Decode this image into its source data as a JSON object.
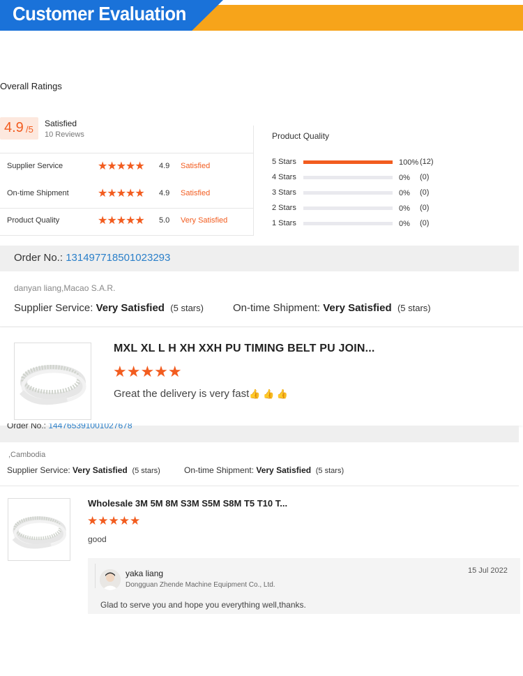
{
  "banner": {
    "title": "Customer Evaluation"
  },
  "overall": {
    "title": "Overall Ratings",
    "score": "4.9",
    "score_suffix": "/5",
    "satisfaction": "Satisfied",
    "reviews": "10 Reviews",
    "rows": [
      {
        "label": "Supplier Service",
        "stars": "★★★★★",
        "score": "4.9",
        "word": "Satisfied"
      },
      {
        "label": "On-time Shipment",
        "stars": "★★★★★",
        "score": "4.9",
        "word": "Satisfied"
      },
      {
        "label": "Product Quality",
        "stars": "★★★★★",
        "score": "5.0",
        "word": "Very Satisfied"
      }
    ]
  },
  "distribution": {
    "title": "Product Quality",
    "rows": [
      {
        "label": "5 Stars",
        "fraction": 1.0,
        "pct": "100%",
        "count": "(12)"
      },
      {
        "label": "4 Stars",
        "fraction": 0.0,
        "pct": "0%",
        "count": "(0)"
      },
      {
        "label": "3 Stars",
        "fraction": 0.0,
        "pct": "0%",
        "count": "(0)"
      },
      {
        "label": "2 Stars",
        "fraction": 0.0,
        "pct": "0%",
        "count": "(0)"
      },
      {
        "label": "1 Stars",
        "fraction": 0.0,
        "pct": "0%",
        "count": "(0)"
      }
    ]
  },
  "review1": {
    "order_label": "Order No.: ",
    "order_number": "131497718501023293",
    "reviewer": "danyan liang,Macao S.A.R.",
    "supplier_label": "Supplier Service: ",
    "supplier_value": "Very Satisfied",
    "supplier_stars": "(5 stars)",
    "shipment_label": "On-time Shipment: ",
    "shipment_value": "Very Satisfied",
    "shipment_stars": "(5 stars)",
    "product_title": "MXL XL L H XH XXH PU TIMING BELT PU JOIN...",
    "stars": "★★★★★",
    "text": "Great the delivery is very fast",
    "emoji": "👍 👍 👍"
  },
  "review2": {
    "order_label": "Order No.: ",
    "order_number": "144765391001027678",
    "reviewer": ",Cambodia",
    "supplier_label": "Supplier Service: ",
    "supplier_value": "Very Satisfied",
    "supplier_stars": "(5 stars)",
    "shipment_label": "On-time Shipment: ",
    "shipment_value": "Very Satisfied",
    "shipment_stars": "(5 stars)",
    "product_title": "Wholesale 3M 5M 8M S3M S5M S8M T5 T10 T...",
    "stars": "★★★★★",
    "text": "good",
    "reply": {
      "name": "yaka liang",
      "company": "Dongguan Zhende Machine Equipment Co., Ltd.",
      "date": "15 Jul 2022",
      "text": "Glad to serve you and hope you everything well,thanks."
    }
  },
  "colors": {
    "accent": "#f25c1f",
    "banner_blue": "#1a72d9",
    "banner_orange": "#f7a41a",
    "link": "#2a7fc9"
  }
}
